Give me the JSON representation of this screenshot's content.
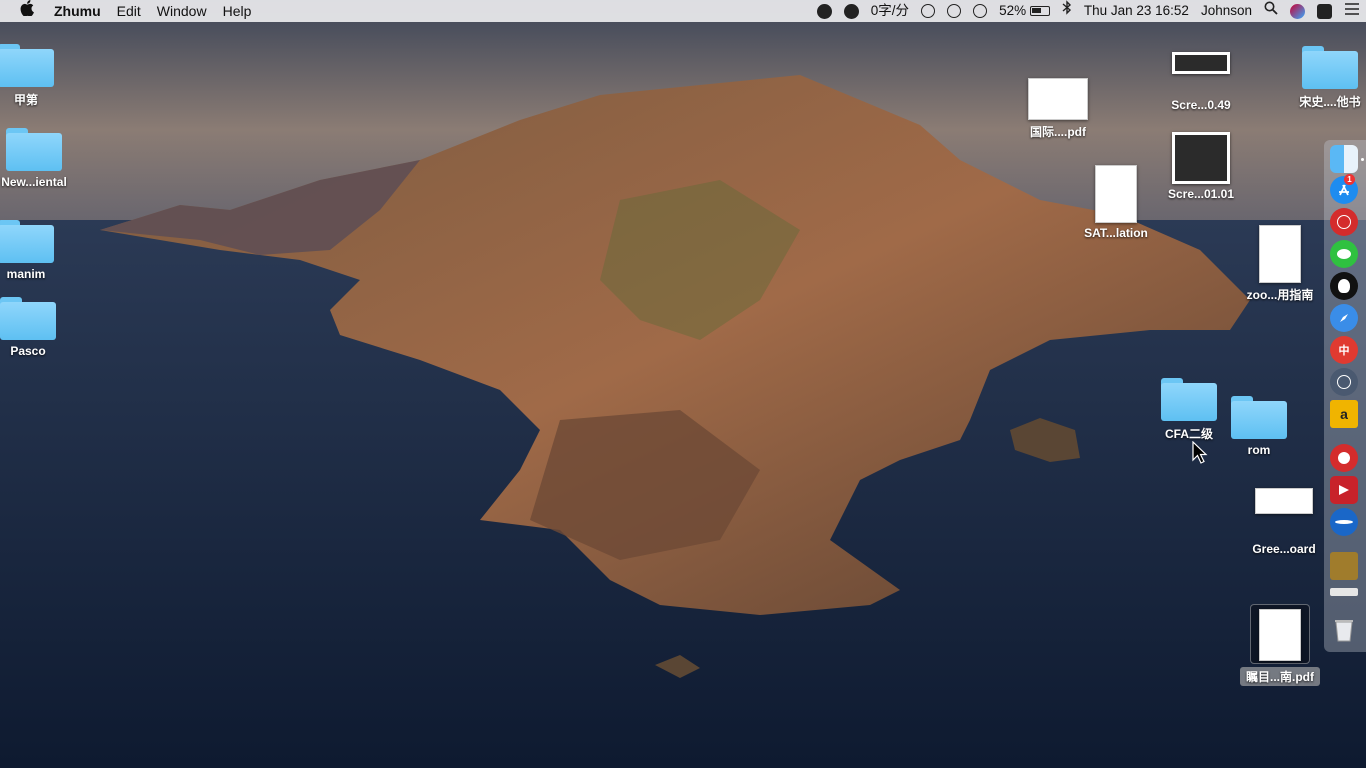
{
  "menubar": {
    "app_name": "Zhumu",
    "menus": [
      "Edit",
      "Window",
      "Help"
    ],
    "status": {
      "typing_speed": "0字/分",
      "battery": "52%",
      "datetime": "Thu Jan 23  16:52",
      "user": "Johnson"
    }
  },
  "desktop_left": [
    {
      "label": "甲第"
    },
    {
      "label": "New...iental"
    },
    {
      "label": "manim"
    },
    {
      "label": "Pasco"
    }
  ],
  "desktop_right": {
    "pdf1": "国际....pdf",
    "scre1": "Scre...0.49",
    "scre2": "Scre...01.01",
    "sat": "SAT...lation",
    "zoo": "zoo...用指南",
    "song": "宋史....他书",
    "cfa": "CFA二级",
    "rom": "rom",
    "gree": "Gree...oard",
    "selected_pdf": "瞩目...南.pdf"
  },
  "dock": {
    "items": [
      "finder-icon",
      "app-store-icon",
      "netease-music-icon",
      "wechat-icon",
      "qq-icon",
      "safari-icon",
      "zhumu-icon",
      "block-icon",
      "amazon-icon",
      "scrobbler-icon",
      "pdf-expert-icon",
      "browser-icon",
      "notes-icon",
      "downloads-stack-icon",
      "trash-icon"
    ],
    "app_store_badge": "1",
    "amazon_label": "a"
  },
  "colors": {
    "folder": "#6cc6f4",
    "menubar": "#ececee"
  }
}
